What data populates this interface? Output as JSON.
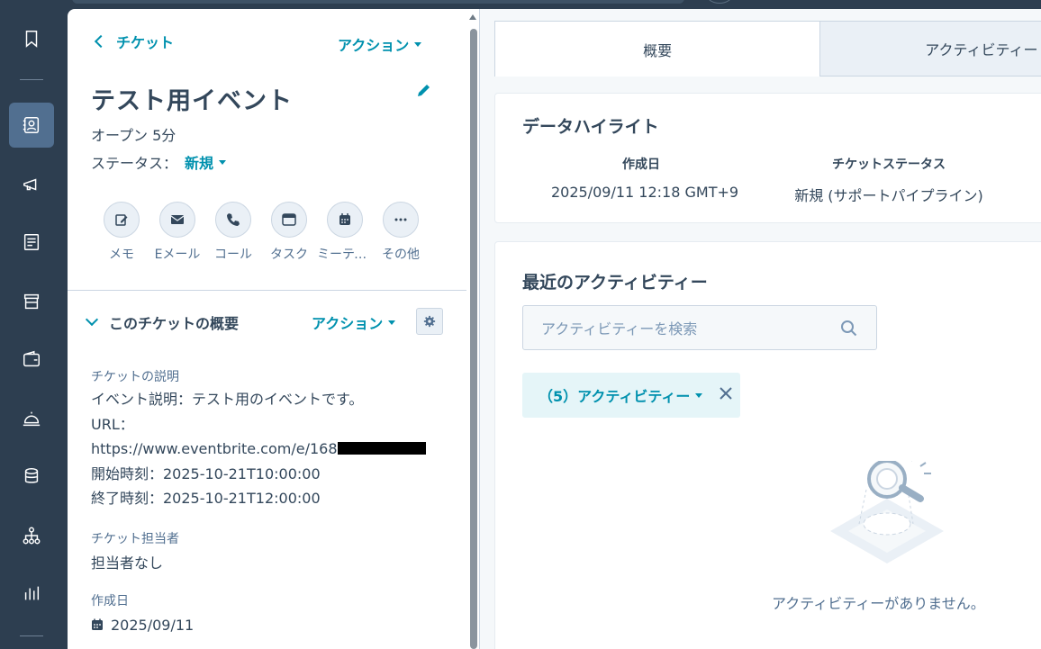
{
  "nav": {
    "items": [
      {
        "icon": "bookmark-icon"
      },
      {
        "icon": "contacts-icon",
        "active": true
      },
      {
        "icon": "megaphone-icon"
      },
      {
        "icon": "newsletter-icon"
      },
      {
        "icon": "store-icon"
      },
      {
        "icon": "wallet-icon"
      },
      {
        "icon": "service-bell-icon"
      },
      {
        "icon": "database-icon"
      },
      {
        "icon": "workflow-icon"
      },
      {
        "icon": "reports-icon"
      }
    ]
  },
  "record": {
    "back_label": "チケット",
    "actions_label": "アクション",
    "title": "テスト用イベント",
    "open_label": "オープン 5分",
    "status_label": "ステータス：",
    "status_value": "新規"
  },
  "quick_actions": [
    {
      "label": "メモ",
      "icon": "note-icon"
    },
    {
      "label": "Eメール",
      "icon": "email-icon"
    },
    {
      "label": "コール",
      "icon": "phone-icon"
    },
    {
      "label": "タスク",
      "icon": "task-icon"
    },
    {
      "label": "ミーティング",
      "icon": "meeting-icon"
    },
    {
      "label": "その他",
      "icon": "more-icon"
    }
  ],
  "summary": {
    "title": "このチケットの概要",
    "actions_label": "アクション",
    "description_label": "チケットの説明",
    "description_lines": [
      "イベント説明：テスト用のイベントです。",
      "URL：",
      "https://www.eventbrite.com/e/168",
      "開始時刻：2025-10-21T10:00:00",
      "終了時刻：2025-10-21T12:00:00"
    ],
    "owner_label": "チケット担当者",
    "owner_value": "担当者なし",
    "created_label": "作成日",
    "created_value": "2025/09/11"
  },
  "tabs": [
    {
      "label": "概要",
      "active": true
    },
    {
      "label": "アクティビティー",
      "active": false
    }
  ],
  "highlights": {
    "title": "データハイライト",
    "created_key": "作成日",
    "created_value": "2025/09/11 12:18 GMT+9",
    "status_key": "チケットステータス",
    "status_value": "新規 (サポートパイプライン)"
  },
  "activity": {
    "title": "最近のアクティビティー",
    "search_placeholder": "アクティビティーを検索",
    "filter_label": "（5）アクティビティー",
    "empty_text": "アクティビティーがありません。"
  },
  "colors": {
    "nav_bg": "#2d3e50",
    "accent": "#0091ae",
    "text": "#33475b"
  }
}
